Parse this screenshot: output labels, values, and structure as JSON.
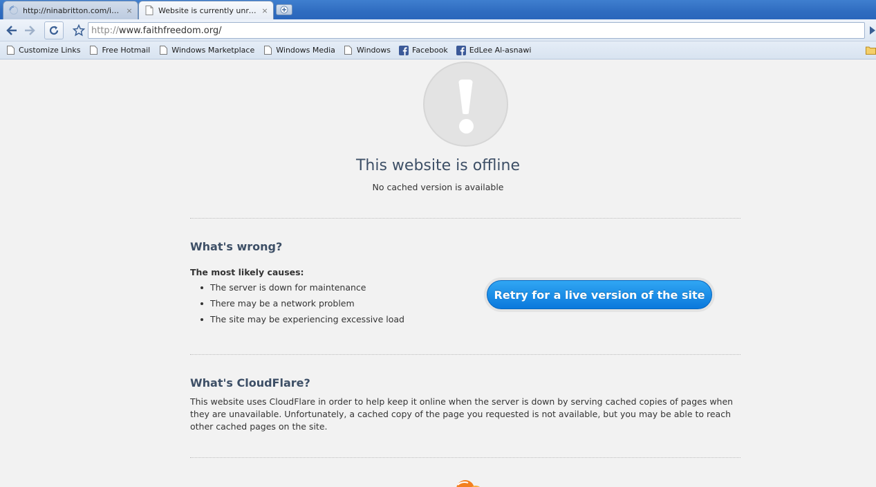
{
  "browser": {
    "tabs": [
      {
        "title": "http://ninabritton.com/ima...",
        "state": "loading",
        "close": "×"
      },
      {
        "title": "Website is currently unreac...",
        "state": "active",
        "close": "×"
      }
    ],
    "address": {
      "scheme": "http://",
      "host": "www.faithfreedom.org/"
    },
    "bookmarks": [
      {
        "label": "Customize Links",
        "icon": "page-icon"
      },
      {
        "label": "Free Hotmail",
        "icon": "page-icon"
      },
      {
        "label": "Windows Marketplace",
        "icon": "page-icon"
      },
      {
        "label": "Windows Media",
        "icon": "page-icon"
      },
      {
        "label": "Windows",
        "icon": "page-icon"
      },
      {
        "label": "Facebook",
        "icon": "facebook-icon"
      },
      {
        "label": "EdLee Al-asnawi",
        "icon": "facebook-icon"
      }
    ]
  },
  "page": {
    "title": "This website is offline",
    "subtitle": "No cached version is available",
    "wrong": {
      "heading": "What's wrong?",
      "causes_title": "The most likely causes:",
      "causes": [
        "The server is down for maintenance",
        "There may be a network problem",
        "The site may be experiencing excessive load"
      ],
      "retry_label": "Retry for a live version of the site"
    },
    "cloudflare": {
      "heading": "What's CloudFlare?",
      "body": "This website uses CloudFlare in order to help keep it online when the server is down by serving cached copies of pages when they are unavailable. Unfortunately, a cached copy of the page you requested is not available, but you may be able to reach other cached pages on the site."
    }
  },
  "colors": {
    "heading": "#3d4f66",
    "retry_button": "#0a78dc",
    "page_bg": "#f2f2f2",
    "cloudflare_orange": "#f38020"
  }
}
